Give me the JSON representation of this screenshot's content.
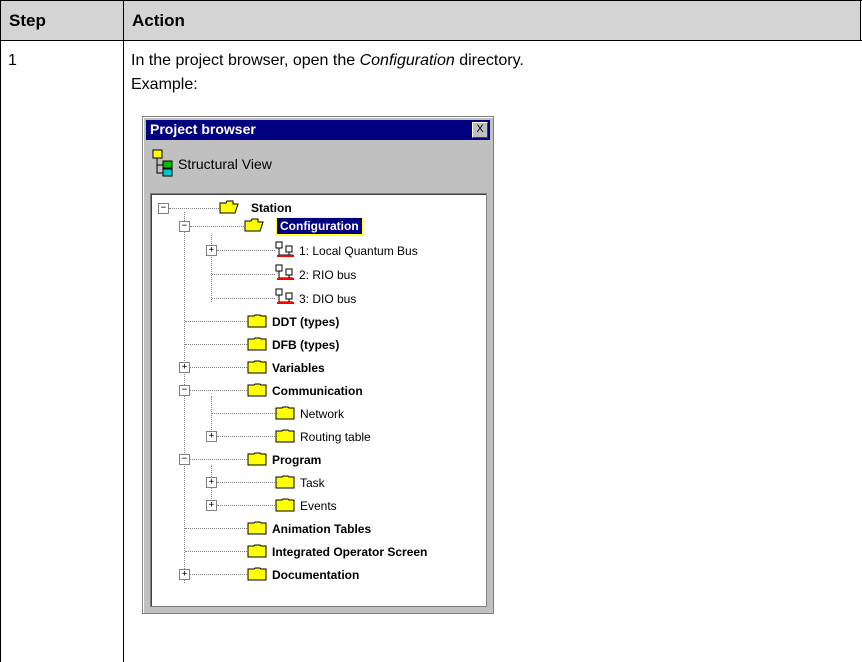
{
  "table": {
    "headers": {
      "step": "Step",
      "action": "Action"
    },
    "rows": [
      {
        "step": "1",
        "action_pre": "In the project browser, open the ",
        "action_italic": "Configuration",
        "action_post": " directory.",
        "example_label": "Example:"
      }
    ]
  },
  "browser": {
    "title": "Project browser",
    "close_glyph": "X",
    "view_label": "Structural View",
    "tree": {
      "station": "Station",
      "configuration": "Configuration",
      "bus1": "1: Local Quantum Bus",
      "bus2": "2: RIO bus",
      "bus3": "3: DIO bus",
      "ddt": "DDT (types)",
      "dfb": "DFB (types)",
      "variables": "Variables",
      "communication": "Communication",
      "network": "Network",
      "routing": "Routing table",
      "program": "Program",
      "task": "Task",
      "events": "Events",
      "animation": "Animation Tables",
      "operator": "Integrated Operator Screen",
      "documentation": "Documentation"
    },
    "expander": {
      "plus": "+",
      "minus": "−"
    },
    "colors": {
      "folder": "#ffff00",
      "selection": "#000080",
      "titlebar": "#000080"
    }
  }
}
